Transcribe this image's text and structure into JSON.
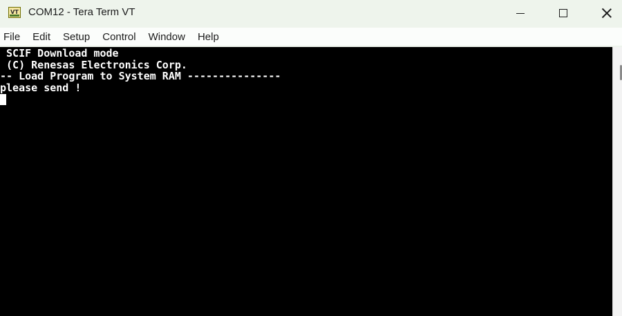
{
  "window": {
    "title": "COM12 - Tera Term VT",
    "icon": "tera-term-vt-icon",
    "icon_text": "VT",
    "controls": {
      "minimize": "minimize-icon",
      "maximize": "maximize-icon",
      "close": "close-icon"
    }
  },
  "menu": {
    "items": [
      {
        "label": "File"
      },
      {
        "label": "Edit"
      },
      {
        "label": "Setup"
      },
      {
        "label": "Control"
      },
      {
        "label": "Window"
      },
      {
        "label": "Help"
      }
    ]
  },
  "terminal": {
    "lines": [
      " SCIF Download mode",
      " (C) Renesas Electronics Corp.",
      "-- Load Program to System RAM ---------------",
      "please send !"
    ],
    "background": "#000000",
    "foreground": "#ffffff"
  }
}
